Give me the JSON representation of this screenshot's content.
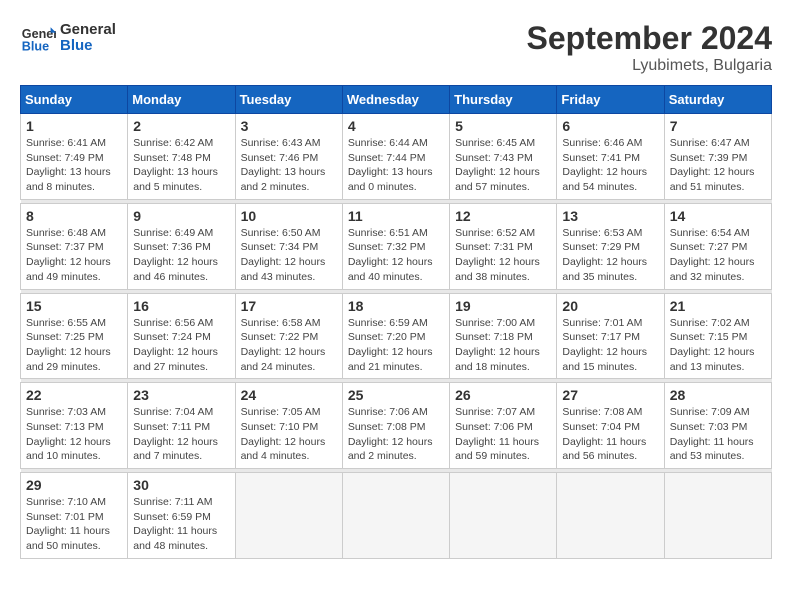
{
  "header": {
    "logo_general": "General",
    "logo_blue": "Blue",
    "month_title": "September 2024",
    "location": "Lyubimets, Bulgaria"
  },
  "weekdays": [
    "Sunday",
    "Monday",
    "Tuesday",
    "Wednesday",
    "Thursday",
    "Friday",
    "Saturday"
  ],
  "weeks": [
    [
      {
        "day": "1",
        "sunrise": "6:41 AM",
        "sunset": "7:49 PM",
        "daylight": "13 hours and 8 minutes."
      },
      {
        "day": "2",
        "sunrise": "6:42 AM",
        "sunset": "7:48 PM",
        "daylight": "13 hours and 5 minutes."
      },
      {
        "day": "3",
        "sunrise": "6:43 AM",
        "sunset": "7:46 PM",
        "daylight": "13 hours and 2 minutes."
      },
      {
        "day": "4",
        "sunrise": "6:44 AM",
        "sunset": "7:44 PM",
        "daylight": "13 hours and 0 minutes."
      },
      {
        "day": "5",
        "sunrise": "6:45 AM",
        "sunset": "7:43 PM",
        "daylight": "12 hours and 57 minutes."
      },
      {
        "day": "6",
        "sunrise": "6:46 AM",
        "sunset": "7:41 PM",
        "daylight": "12 hours and 54 minutes."
      },
      {
        "day": "7",
        "sunrise": "6:47 AM",
        "sunset": "7:39 PM",
        "daylight": "12 hours and 51 minutes."
      }
    ],
    [
      {
        "day": "8",
        "sunrise": "6:48 AM",
        "sunset": "7:37 PM",
        "daylight": "12 hours and 49 minutes."
      },
      {
        "day": "9",
        "sunrise": "6:49 AM",
        "sunset": "7:36 PM",
        "daylight": "12 hours and 46 minutes."
      },
      {
        "day": "10",
        "sunrise": "6:50 AM",
        "sunset": "7:34 PM",
        "daylight": "12 hours and 43 minutes."
      },
      {
        "day": "11",
        "sunrise": "6:51 AM",
        "sunset": "7:32 PM",
        "daylight": "12 hours and 40 minutes."
      },
      {
        "day": "12",
        "sunrise": "6:52 AM",
        "sunset": "7:31 PM",
        "daylight": "12 hours and 38 minutes."
      },
      {
        "day": "13",
        "sunrise": "6:53 AM",
        "sunset": "7:29 PM",
        "daylight": "12 hours and 35 minutes."
      },
      {
        "day": "14",
        "sunrise": "6:54 AM",
        "sunset": "7:27 PM",
        "daylight": "12 hours and 32 minutes."
      }
    ],
    [
      {
        "day": "15",
        "sunrise": "6:55 AM",
        "sunset": "7:25 PM",
        "daylight": "12 hours and 29 minutes."
      },
      {
        "day": "16",
        "sunrise": "6:56 AM",
        "sunset": "7:24 PM",
        "daylight": "12 hours and 27 minutes."
      },
      {
        "day": "17",
        "sunrise": "6:58 AM",
        "sunset": "7:22 PM",
        "daylight": "12 hours and 24 minutes."
      },
      {
        "day": "18",
        "sunrise": "6:59 AM",
        "sunset": "7:20 PM",
        "daylight": "12 hours and 21 minutes."
      },
      {
        "day": "19",
        "sunrise": "7:00 AM",
        "sunset": "7:18 PM",
        "daylight": "12 hours and 18 minutes."
      },
      {
        "day": "20",
        "sunrise": "7:01 AM",
        "sunset": "7:17 PM",
        "daylight": "12 hours and 15 minutes."
      },
      {
        "day": "21",
        "sunrise": "7:02 AM",
        "sunset": "7:15 PM",
        "daylight": "12 hours and 13 minutes."
      }
    ],
    [
      {
        "day": "22",
        "sunrise": "7:03 AM",
        "sunset": "7:13 PM",
        "daylight": "12 hours and 10 minutes."
      },
      {
        "day": "23",
        "sunrise": "7:04 AM",
        "sunset": "7:11 PM",
        "daylight": "12 hours and 7 minutes."
      },
      {
        "day": "24",
        "sunrise": "7:05 AM",
        "sunset": "7:10 PM",
        "daylight": "12 hours and 4 minutes."
      },
      {
        "day": "25",
        "sunrise": "7:06 AM",
        "sunset": "7:08 PM",
        "daylight": "12 hours and 2 minutes."
      },
      {
        "day": "26",
        "sunrise": "7:07 AM",
        "sunset": "7:06 PM",
        "daylight": "11 hours and 59 minutes."
      },
      {
        "day": "27",
        "sunrise": "7:08 AM",
        "sunset": "7:04 PM",
        "daylight": "11 hours and 56 minutes."
      },
      {
        "day": "28",
        "sunrise": "7:09 AM",
        "sunset": "7:03 PM",
        "daylight": "11 hours and 53 minutes."
      }
    ],
    [
      {
        "day": "29",
        "sunrise": "7:10 AM",
        "sunset": "7:01 PM",
        "daylight": "11 hours and 50 minutes."
      },
      {
        "day": "30",
        "sunrise": "7:11 AM",
        "sunset": "6:59 PM",
        "daylight": "11 hours and 48 minutes."
      },
      null,
      null,
      null,
      null,
      null
    ]
  ]
}
